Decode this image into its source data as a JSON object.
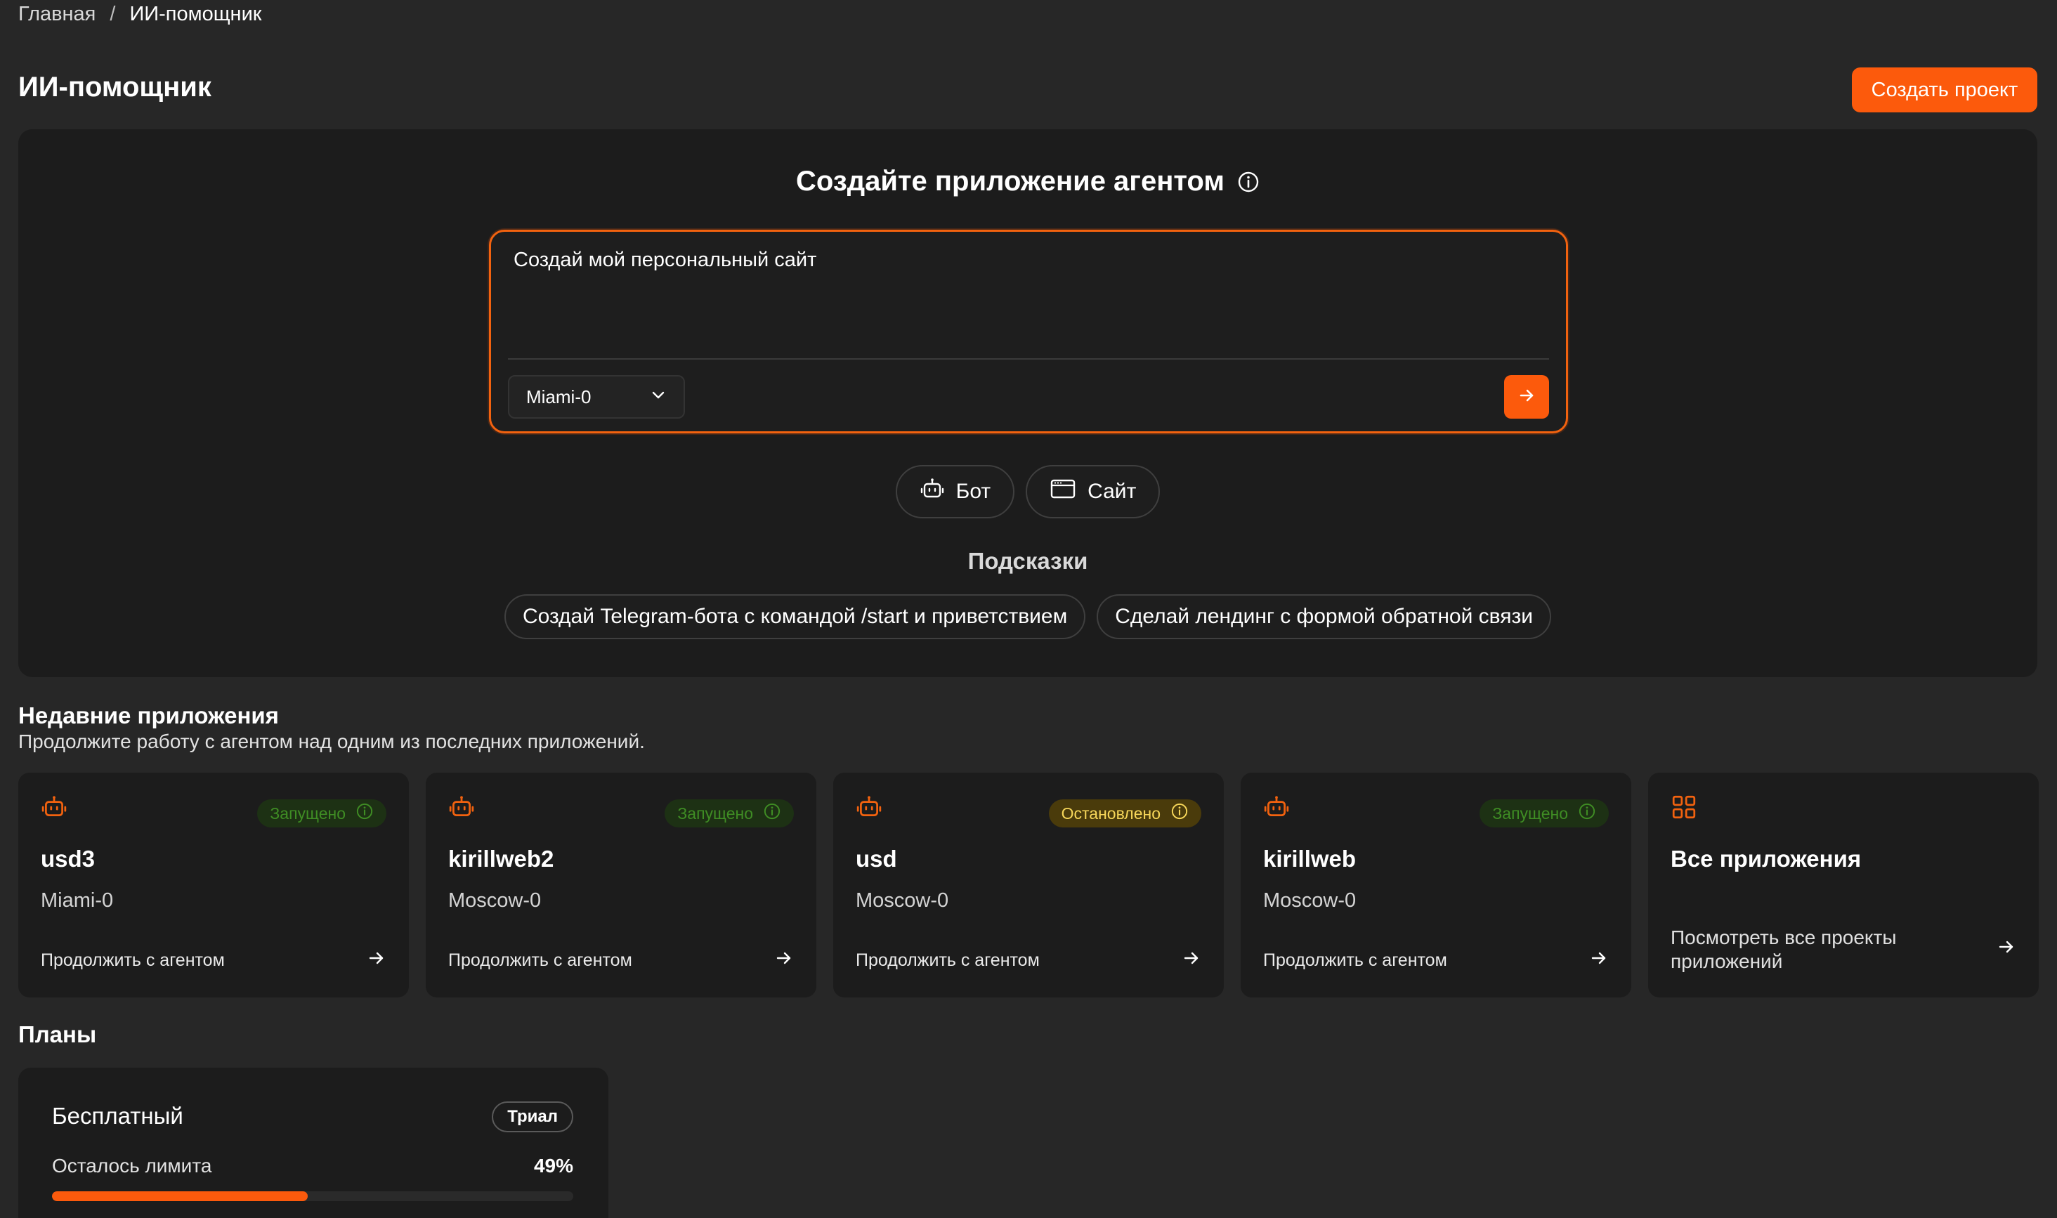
{
  "breadcrumb": {
    "home": "Главная",
    "separator": "/",
    "current": "ИИ-помощник"
  },
  "header": {
    "title": "ИИ-помощник",
    "create_project_label": "Создать проект"
  },
  "hero": {
    "title": "Создайте приложение агентом",
    "prompt_value": "Создай мой персональный сайт",
    "model_selected": "Miami-0",
    "modes": [
      {
        "label": "Бот",
        "icon": "bot-icon"
      },
      {
        "label": "Сайт",
        "icon": "browser-window-icon"
      }
    ],
    "hints_title": "Подсказки",
    "hints": [
      "Создай Telegram-бота с командой /start и приветствием",
      "Сделай лендинг с формой обратной связи"
    ]
  },
  "recent": {
    "title": "Недавние приложения",
    "subtitle": "Продолжите работу с агентом над одним из последних приложений.",
    "apps": [
      {
        "name": "usd3",
        "region": "Miami-0",
        "status": "Запущено",
        "status_kind": "running",
        "action": "Продолжить с агентом"
      },
      {
        "name": "kirillweb2",
        "region": "Moscow-0",
        "status": "Запущено",
        "status_kind": "running",
        "action": "Продолжить с агентом"
      },
      {
        "name": "usd",
        "region": "Moscow-0",
        "status": "Остановлено",
        "status_kind": "stopped",
        "action": "Продолжить с агентом"
      },
      {
        "name": "kirillweb",
        "region": "Moscow-0",
        "status": "Запущено",
        "status_kind": "running",
        "action": "Продолжить с агентом"
      }
    ],
    "all_apps": {
      "title": "Все приложения",
      "description": "Посмотреть все проекты приложений"
    }
  },
  "plans": {
    "title": "Планы",
    "items": [
      {
        "name": "Бесплатный",
        "badge": "Триал",
        "limit_label": "Осталось лимита",
        "limit_value": "49%",
        "limit_fraction": 0.49
      }
    ]
  },
  "colors": {
    "accent": "#fc5a0c",
    "running": "#3f8d24",
    "stopped": "#f7d75a"
  }
}
